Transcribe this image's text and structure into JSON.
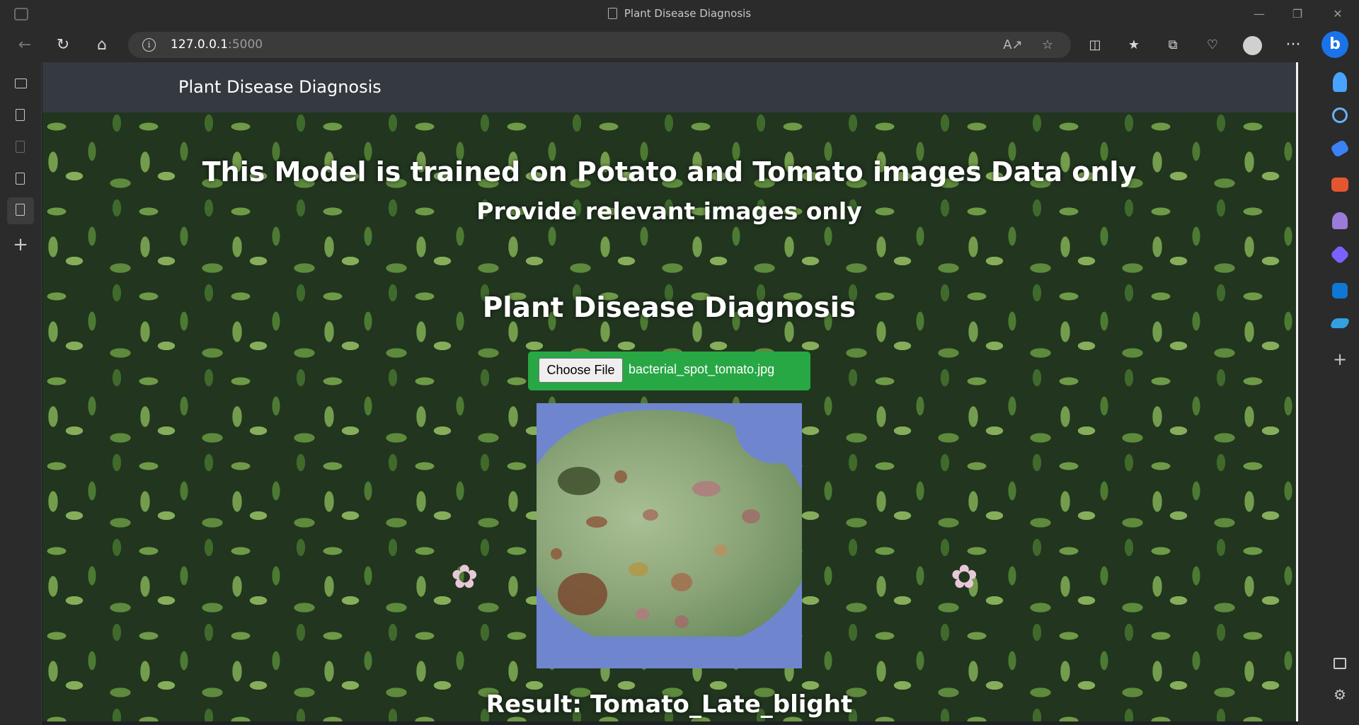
{
  "browser": {
    "tab_title": "Plant Disease Diagnosis",
    "url_host": "127.0.0.1",
    "url_port": ":5000",
    "info_glyph": "i",
    "icons": [
      "back-icon",
      "refresh-icon",
      "home-icon",
      "read-aloud-icon",
      "favorite-star-icon",
      "split-screen-icon",
      "favorites-icon",
      "collections-icon",
      "performance-icon",
      "profile-icon",
      "more-icon",
      "copilot-icon"
    ]
  },
  "sidebar_right": {
    "icons": [
      "bell-icon",
      "search-icon",
      "shopping-tag-icon",
      "toolbox-icon",
      "games-icon",
      "copilot-app-icon",
      "outlook-icon",
      "drop-icon",
      "add-icon",
      "sidebar-toggle-icon",
      "settings-icon"
    ],
    "colors": {
      "bell": "#4aa3ff",
      "search": "#6ab0ff",
      "tag": "#3b82f6",
      "toolbox": "#e4572e",
      "games": "#9a7bd9",
      "copilot": "#7b61ff",
      "outlook": "#0f78d4",
      "drop": "#33a1e0"
    }
  },
  "page": {
    "navbar_brand": "Plant Disease Diagnosis",
    "heading_main": "This Model is trained on Potato and Tomato images Data only",
    "heading_sub": "Provide relevant images only",
    "section_title": "Plant Disease Diagnosis",
    "file_button_label": "Choose File",
    "file_name": "bacterial_spot_tomato.jpg",
    "result_text": "Result: Tomato_Late_blight",
    "accent_color": "#28a745",
    "navbar_color": "#343a40"
  }
}
